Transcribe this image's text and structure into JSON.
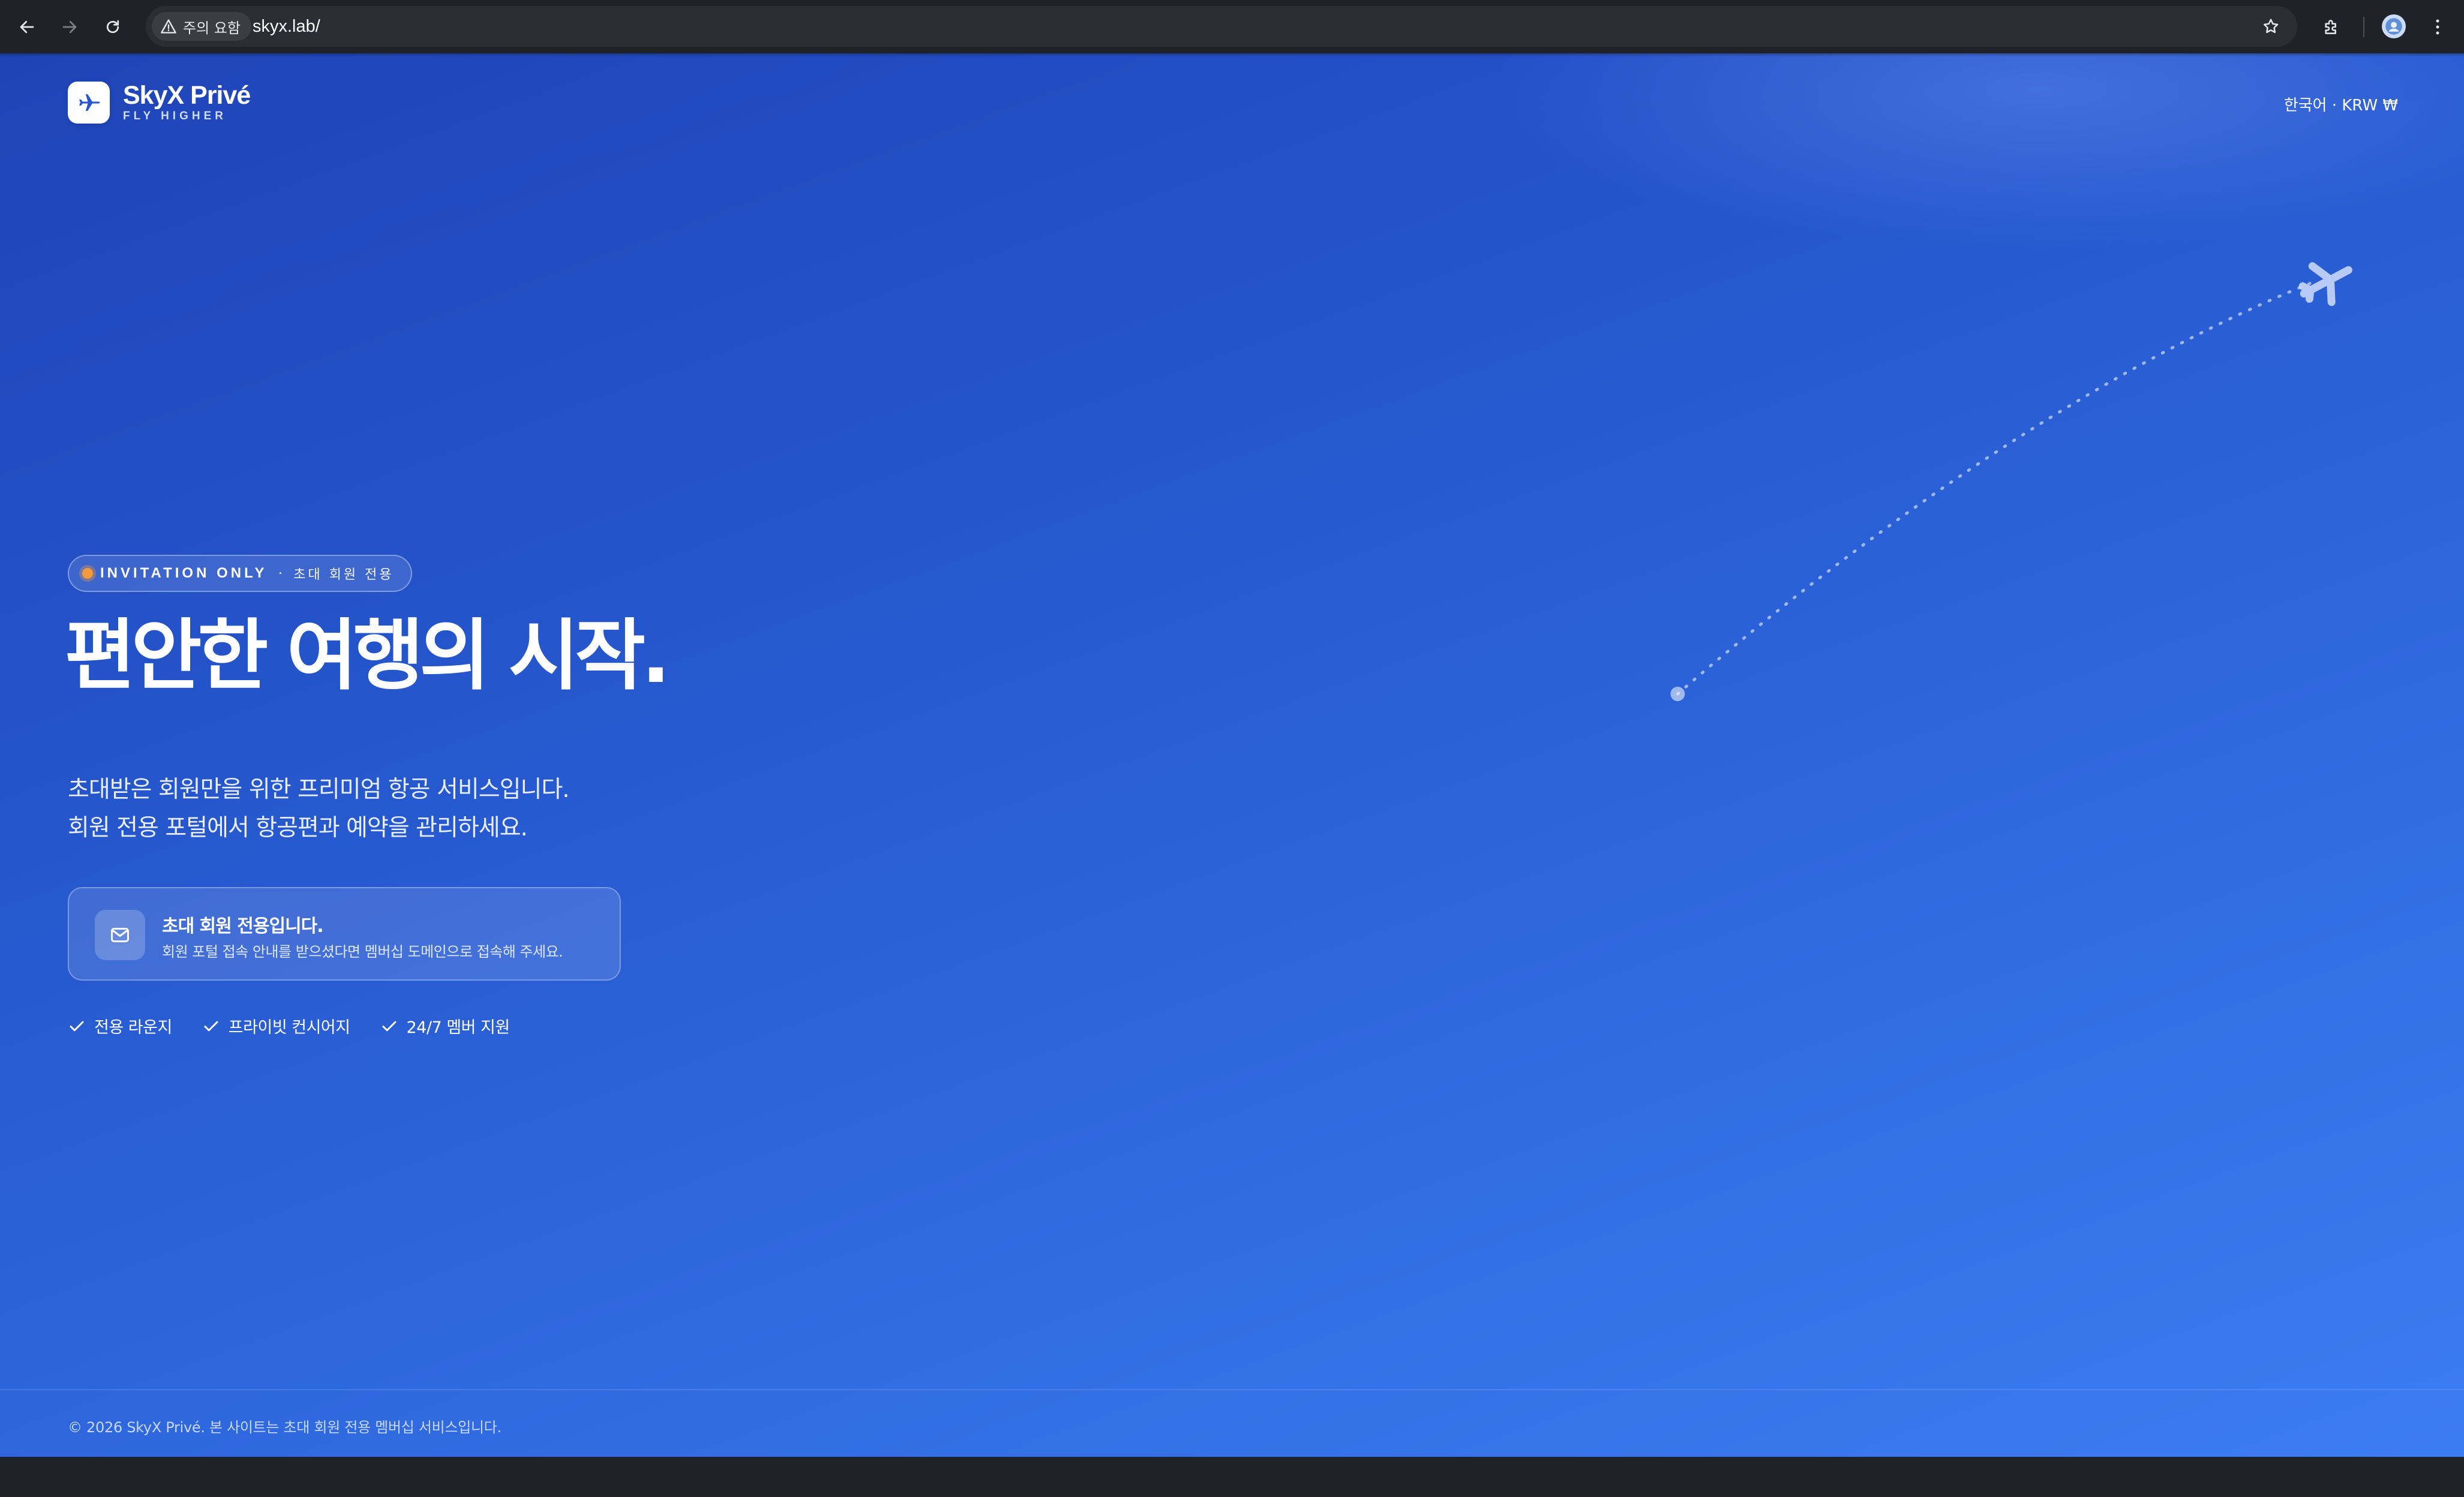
{
  "browser": {
    "security_label": "주의 요함",
    "url": "skyx.lab/",
    "icons": [
      "back-arrow-icon",
      "forward-arrow-icon",
      "reload-icon",
      "warning-icon",
      "star-icon",
      "extensions-icon",
      "profile-avatar",
      "kebab-menu-icon"
    ]
  },
  "header": {
    "brand_name": "SkyX Privé",
    "brand_tagline": "FLY HIGHER",
    "locale": "한국어 · KRW ₩",
    "logo_icon": "airplane-icon"
  },
  "hero": {
    "badge_en": "INVITATION ONLY",
    "badge_sep": "·",
    "badge_ko": "초대 회원 전용",
    "title": "편안한 여행의 시작.",
    "subtitle_line1": "초대받은 회원만을 위한 프리미엄 항공 서비스입니다.",
    "subtitle_line2": "회원 전용 포털에서 항공편과 예약을 관리하세요."
  },
  "notice": {
    "icon": "mail-icon",
    "title": "초대 회원 전용입니다.",
    "description": "회원 포털 접속 안내를 받으셨다면 멤버십 도메인으로 접속해 주세요."
  },
  "features": [
    {
      "label": "전용 라운지"
    },
    {
      "label": "프라이빗 컨시어지"
    },
    {
      "label": "24/7 멤버 지원"
    }
  ],
  "footer": {
    "copyright": "© 2026 SkyX Privé. 본 사이트는 초대 회원 전용 멤버십 서비스입니다."
  },
  "colors": {
    "background_start": "#1f44b8",
    "background_end": "#3c7cf2",
    "badge_dot": "#f29a3c",
    "chrome_bg": "#1f2228"
  }
}
